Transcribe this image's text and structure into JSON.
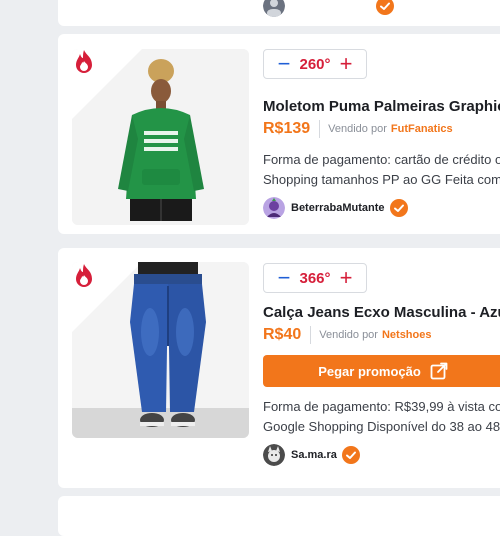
{
  "colors": {
    "accent": "#f2761b",
    "hot": "#d61f3a",
    "background": "#eceef1"
  },
  "deals": [
    {
      "temperature": "260°",
      "title": "Moletom Puma Palmeiras Graphic",
      "price": "R$139",
      "sold_by_label": "Vendido por",
      "merchant": "FutFanatics",
      "description_line1": "Forma de pagamento: cartão de crédito o",
      "description_line2": "Shopping tamanhos PP ao GG Feita com",
      "author": "BeterrabaMutante",
      "image_icon": "green-hoodie-photo"
    },
    {
      "temperature": "366°",
      "title": "Calça Jeans Ecxo Masculina - Azu",
      "price": "R$40",
      "sold_by_label": "Vendido por",
      "merchant": "Netshoes",
      "cta_label": "Pegar promoção",
      "description_line1": "Forma de pagamento: R$39,99 à vista co",
      "description_line2": "Google Shopping Disponível do 38 ao 48",
      "author": "Sa.ma.ra",
      "image_icon": "blue-jeans-photo"
    }
  ],
  "icons": {
    "hot": "flame-icon",
    "verified": "verified-check-icon",
    "cta": "external-link-icon",
    "minus": "minus-icon",
    "plus": "plus-icon"
  },
  "temp_controls": {
    "minus": "−",
    "plus": "+"
  }
}
